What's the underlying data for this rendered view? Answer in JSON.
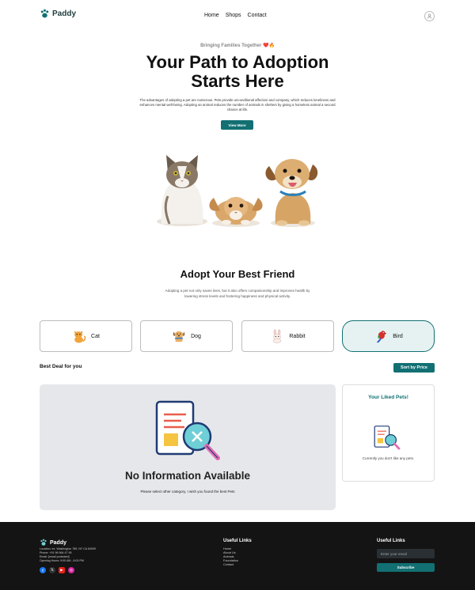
{
  "brand": {
    "name": "Paddy"
  },
  "nav": {
    "items": [
      "Home",
      "Shops",
      "Contact"
    ]
  },
  "hero": {
    "tagline": "Bringing Families Together ❤️🔥",
    "title_line1": "Your Path to Adoption",
    "title_line2": "Starts Here",
    "description": "The advantages of adopting a pet are numerous. Pets provide unconditional affection and company, which reduces loneliness and enhances mental well-being. Adopting an animal reduces the number of animals in shelters by giving a homeless animal a second chance at life.",
    "cta_label": "View More"
  },
  "adopt": {
    "title": "Adopt Your Best Friend",
    "description": "Adopting a pet not only saves lives, but it also offers companionship and improves health by lowering stress levels and fostering happiness and physical activity."
  },
  "categories": [
    {
      "label": "Cat",
      "icon": "cat-icon"
    },
    {
      "label": "Dog",
      "icon": "dog-icon"
    },
    {
      "label": "Rabbit",
      "icon": "rabbit-icon"
    },
    {
      "label": "Bird",
      "icon": "bird-icon",
      "selected": true
    }
  ],
  "listing": {
    "heading": "Best Deal for you",
    "sort_label": "Sort by Price",
    "empty_title": "No Information Available",
    "empty_subtitle": "Please select other category, I wish you found the best Pets"
  },
  "liked": {
    "title": "Your Liked Pets!",
    "empty_text": "Currently you don't like any pets."
  },
  "footer": {
    "brand": "Paddy",
    "info": [
      "Location: ex. Washington 789, NY CA 84009",
      "Phone: +91 98 964 47 95",
      "Email: [email protected]",
      "Opening Hours: 9:00 AM - 6:00 PM"
    ],
    "social": [
      "facebook-icon",
      "x-icon",
      "youtube-icon",
      "instagram-icon"
    ],
    "links_title": "Useful Links",
    "links": [
      "Home",
      "About Us",
      "Animals",
      "Foundation",
      "Contact"
    ],
    "subscribe_title": "Useful Links",
    "email_placeholder": "Enter your email",
    "subscribe_label": "Subscribe"
  },
  "colors": {
    "accent": "#127073",
    "footer_bg": "#141414",
    "panel_bg": "#e6e7ea"
  }
}
